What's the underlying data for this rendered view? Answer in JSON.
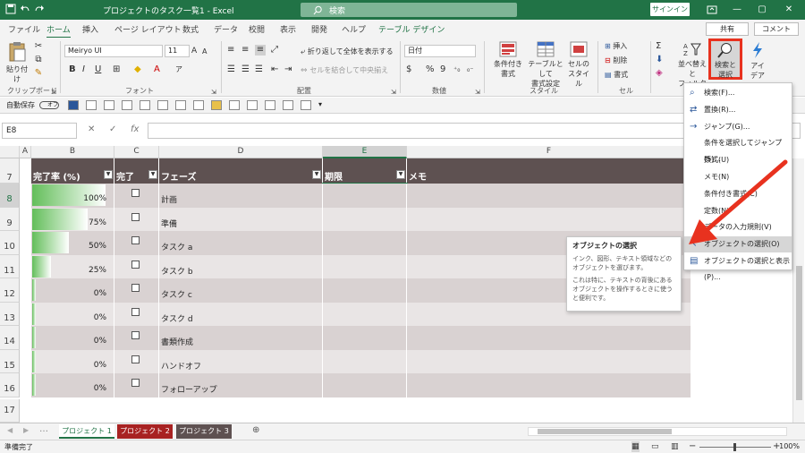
{
  "window": {
    "title": "プロジェクトのタスク一覧1  -  Excel",
    "search_label": "検索",
    "signin": "サインイン",
    "minimize": "—",
    "restore": "▢",
    "close": "✕"
  },
  "tabs": [
    "ファイル",
    "ホーム",
    "挿入",
    "ページ レイアウト",
    "数式",
    "データ",
    "校閲",
    "表示",
    "開発",
    "ヘルプ",
    "テーブル デザイン"
  ],
  "share_label": "共有",
  "comment_label": "コメント",
  "ribbon": {
    "paste": "貼り付け",
    "clipboard": "クリップボード",
    "font_name": "Meiryo UI",
    "font_size": "11",
    "bold": "B",
    "italic": "I",
    "underline": "U",
    "font_group": "フォント",
    "wrap_text": "折り返して全体を表示する",
    "merge_center": "セルを結合して中央揃え",
    "alignment_group": "配置",
    "number_format": "日付",
    "number_group": "数値",
    "cond_format_1": "条件付き",
    "cond_format_2": "書式",
    "table_format_1": "テーブルとして",
    "table_format_2": "書式設定",
    "cell_style_1": "セルの",
    "cell_style_2": "スタイル",
    "style_group": "スタイル",
    "insert": "挿入",
    "delete": "削除",
    "format": "書式",
    "cells_group": "セル",
    "sort_filter_1": "並べ替えと",
    "sort_filter_2": "フィルター",
    "find_select_1": "検索と",
    "find_select_2": "選択",
    "ideas_1": "アイ",
    "ideas_2": "デア",
    "percent": "%",
    "comma": "9"
  },
  "qab": {
    "autosave": "自動保存",
    "toggle": "オフ"
  },
  "formula_bar": {
    "namebox": "E8",
    "cancel": "✕",
    "enter": "✓",
    "fx": "fx"
  },
  "columns": [
    "A",
    "B",
    "C",
    "D",
    "E",
    "F"
  ],
  "headers": {
    "progress": "完了率 (%)",
    "done": "完了",
    "phase": "フェーズ",
    "due": "期限",
    "memo": "メモ"
  },
  "row_numbers": [
    "7",
    "8",
    "9",
    "10",
    "11",
    "12",
    "13",
    "14",
    "15",
    "16",
    "17"
  ],
  "rows": [
    {
      "pct": "100%",
      "value": 1.0,
      "phase": "計画"
    },
    {
      "pct": "75%",
      "value": 0.75,
      "phase": "準備"
    },
    {
      "pct": "50%",
      "value": 0.5,
      "phase": "タスク a"
    },
    {
      "pct": "25%",
      "value": 0.25,
      "phase": "タスク b"
    },
    {
      "pct": "0%",
      "value": 0.0,
      "phase": "タスク c"
    },
    {
      "pct": "0%",
      "value": 0.0,
      "phase": "タスク d"
    },
    {
      "pct": "0%",
      "value": 0.0,
      "phase": "書類作成"
    },
    {
      "pct": "0%",
      "value": 0.0,
      "phase": "ハンドオフ"
    },
    {
      "pct": "0%",
      "value": 0.0,
      "phase": "フォローアップ"
    }
  ],
  "sheets": [
    "プロジェクト 1",
    "プロジェクト 2",
    "プロジェクト 3"
  ],
  "status": {
    "ready": "準備完了",
    "zoom": "100%"
  },
  "menu": [
    {
      "label": "検索(F)...",
      "icon": "⌕"
    },
    {
      "label": "置換(R)...",
      "icon": "⇄"
    },
    {
      "label": "ジャンプ(G)...",
      "icon": "→"
    },
    {
      "label": "条件を選択してジャンプ(S)...",
      "icon": ""
    },
    {
      "label": "数式(U)",
      "icon": ""
    },
    {
      "label": "メモ(N)",
      "icon": ""
    },
    {
      "label": "条件付き書式(C)",
      "icon": ""
    },
    {
      "label": "定数(N)",
      "icon": ""
    },
    {
      "label": "データの入力規則(V)",
      "icon": ""
    },
    {
      "label": "オブジェクトの選択(O)",
      "icon": "↖"
    },
    {
      "label": "オブジェクトの選択と表示(P)...",
      "icon": "▤"
    }
  ],
  "tooltip": {
    "title": "オブジェクトの選択",
    "line1": "インク、図形、テキスト領域などのオブジェクトを選びます。",
    "line2": "これは特に、テキストの背後にあるオブジェクトを操作するときに使うと便利です。"
  },
  "colors": {
    "excel_green": "#217346",
    "header_dark": "#5e5151",
    "row_shade": "#d9d2d2",
    "annotation_red": "#e8321f"
  }
}
